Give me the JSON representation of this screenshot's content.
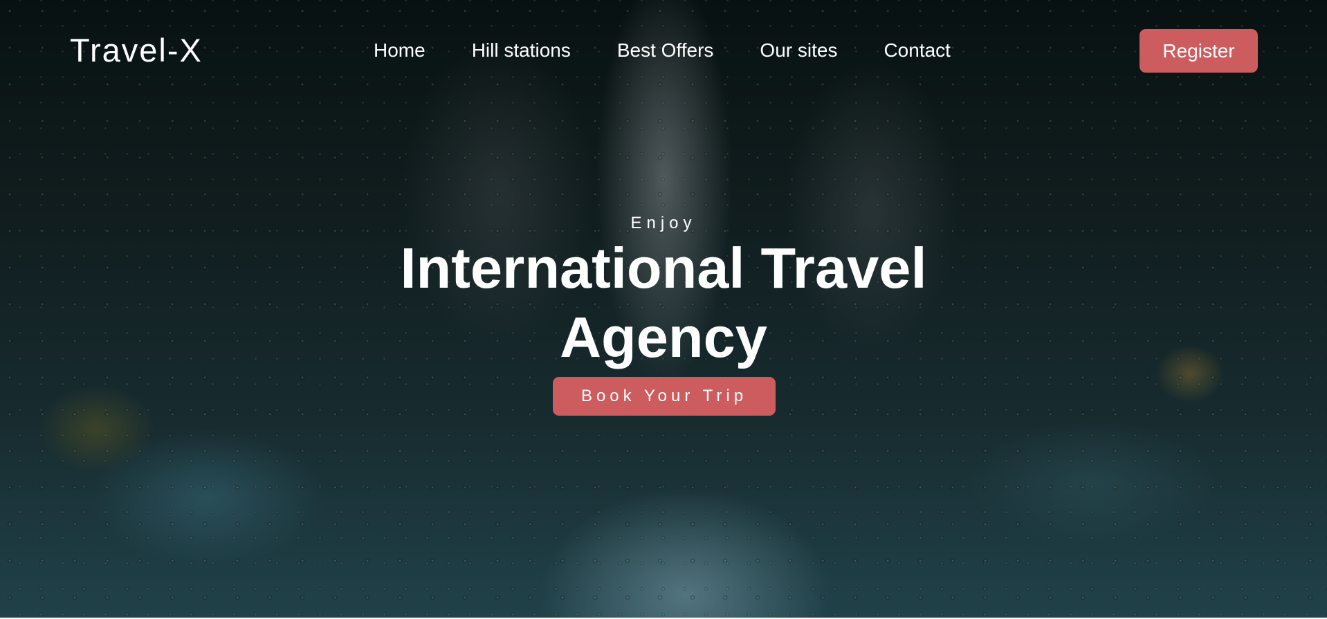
{
  "header": {
    "logo": "Travel-X",
    "nav": [
      "Home",
      "Hill stations",
      "Best Offers",
      "Our sites",
      "Contact"
    ],
    "register_label": "Register"
  },
  "hero": {
    "subtitle": "Enjoy",
    "headline": "International Travel Agency",
    "cta_label": "Book Your Trip",
    "background": "rainy city street through window",
    "accent_color": "#cd5c5f"
  }
}
